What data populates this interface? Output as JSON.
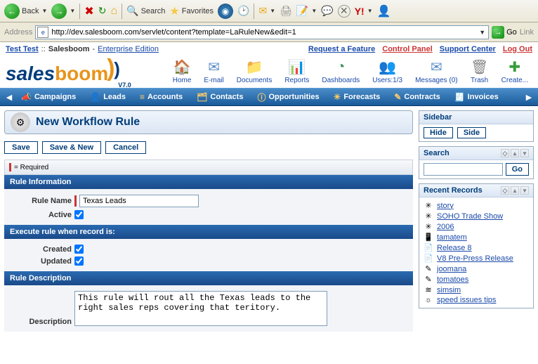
{
  "browser": {
    "back_label": "Back",
    "search_label": "Search",
    "favorites_label": "Favorites",
    "go_label": "Go",
    "address_label": "Address",
    "links_label": "Link",
    "url": "http://dev.salesboom.com/servlet/content?template=LaRuleNew&edit=1"
  },
  "top_links": {
    "user": "Test Test",
    "app": "Salesboom",
    "edition": "Enterprise Edition",
    "request": "Request a Feature",
    "control_panel": "Control Panel",
    "support": "Support Center",
    "logout": "Log Out"
  },
  "logo": {
    "part1": "sales",
    "part2": "boom",
    "version": "V7.0"
  },
  "shortcuts": [
    {
      "label": "Home",
      "icon": "🏠",
      "color": "#e8a43a"
    },
    {
      "label": "E-mail",
      "icon": "✉",
      "color": "#5a8cc8"
    },
    {
      "label": "Documents",
      "icon": "📁",
      "color": "#e8a43a"
    },
    {
      "label": "Reports",
      "icon": "📊",
      "color": "#7a5aaa"
    },
    {
      "label": "Dashboards",
      "icon": "◔",
      "color": "#3a8c5a"
    },
    {
      "label": "Users:1/3",
      "icon": "👥",
      "color": "#c86a2a"
    },
    {
      "label": "Messages (0)",
      "icon": "✉",
      "color": "#5a8cc8"
    },
    {
      "label": "Trash",
      "icon": "🗑",
      "color": "#888"
    },
    {
      "label": "Create...",
      "icon": "✚",
      "color": "#3a9c3a"
    }
  ],
  "nav": [
    "Campaigns",
    "Leads",
    "Accounts",
    "Contacts",
    "Opportunities",
    "Forecasts",
    "Contracts",
    "Invoices"
  ],
  "nav_icons": [
    "📣",
    "👤",
    "≡",
    "🗂",
    "ⓘ",
    "☀",
    "✎",
    "🧾"
  ],
  "page": {
    "title": "New Workflow Rule"
  },
  "buttons": {
    "save": "Save",
    "save_new": "Save & New",
    "cancel": "Cancel"
  },
  "req_note": "= Required",
  "sections": {
    "info": "Rule Information",
    "exec": "Execute rule when record is:",
    "desc": "Rule Description"
  },
  "fields": {
    "rule_name_label": "Rule Name",
    "rule_name_value": "Texas Leads",
    "active_label": "Active",
    "active_value": true,
    "created_label": "Created",
    "created_value": true,
    "updated_label": "Updated",
    "updated_value": true,
    "description_label": "Description",
    "description_value": "This rule will rout all the Texas leads to the right sales reps covering that teritory."
  },
  "sidebar": {
    "title": "Sidebar",
    "hide": "Hide",
    "side": "Side",
    "search_title": "Search",
    "go": "Go",
    "recent_title": "Recent Records",
    "records": [
      {
        "icon": "✳",
        "label": "story"
      },
      {
        "icon": "✳",
        "label": "SOHO Trade Show"
      },
      {
        "icon": "✳",
        "label": "2006"
      },
      {
        "icon": "📱",
        "label": "tamatem"
      },
      {
        "icon": "📄",
        "label": "Release 8"
      },
      {
        "icon": "📄",
        "label": "V8 Pre-Press Release"
      },
      {
        "icon": "✎",
        "label": "joomana"
      },
      {
        "icon": "✎",
        "label": "tomatoes"
      },
      {
        "icon": "≋",
        "label": "simsim"
      },
      {
        "icon": "☼",
        "label": "speed issues tips"
      }
    ]
  }
}
